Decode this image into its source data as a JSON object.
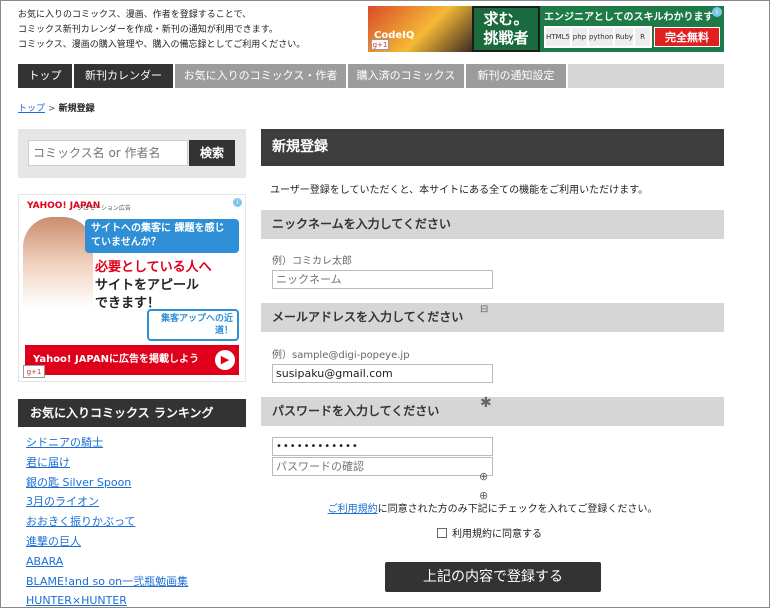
{
  "header": {
    "intro_lines": [
      "お気に入りのコミックス、漫画、作者を登録することで、",
      "コミックス新刊カレンダーを作成・新刊の通知が利用できます。",
      "コミックス、漫画の購入管理や、購入の備忘録としてご利用ください。"
    ],
    "ad": {
      "left_text": "CodeIQ",
      "gplus": "g+1",
      "catch_line1": "求む。",
      "catch_line2": "挑戦者",
      "headline": "エンジニアとしてのスキルわかります",
      "logos": [
        "HTML5",
        "php",
        "python",
        "Ruby",
        "R"
      ],
      "free_label": "完全無料",
      "info_icon": "info-icon"
    }
  },
  "nav": {
    "items": [
      {
        "label": "トップ",
        "active": true
      },
      {
        "label": "新刊カレンダー",
        "active": true
      },
      {
        "label": "お気に入りのコミックス・作者",
        "active": false
      },
      {
        "label": "購入済のコミックス",
        "active": false
      },
      {
        "label": "新刊の通知設定",
        "active": false
      }
    ]
  },
  "breadcrumb": {
    "home": "トップ",
    "separator": ">",
    "current": "新規登録"
  },
  "search": {
    "placeholder": "コミックス名 or 作者名",
    "button": "検索"
  },
  "sidebar_ad": {
    "logo": "YAHOO! JAPAN",
    "promo_label": "プロモーション広告",
    "bubble": "サイトへの集客に 課題を感じていませんか？",
    "line1": "必要としている人へ",
    "line2": "サイトをアピール",
    "line3": "できます！",
    "badge": "集客アップへの近道！",
    "bar_text": "Yahoo! JAPANに広告を掲載しよう",
    "arrow": "▶",
    "gplus": "g+1",
    "info_icon": "info-icon"
  },
  "ranking": {
    "title": "お気に入りコミックス ランキング",
    "items": [
      "シドニアの騎士",
      "君に届け",
      "銀の匙 Silver Spoon",
      "3月のライオン",
      "おおきく振りかぶって",
      "進撃の巨人",
      "ABARA",
      "BLAME!and so on一弐瓶勉画集",
      "HUNTER×HUNTER"
    ]
  },
  "form": {
    "title": "新規登録",
    "intro": "ユーザー登録をしていただくと、本サイトにある全ての機能をご利用いただけます。",
    "nickname": {
      "heading": "ニックネームを入力してください",
      "example": "例）コミカレ太郎",
      "placeholder": "ニックネーム"
    },
    "email": {
      "heading": "メールアドレスを入力してください",
      "example": "例）sample@digi-popeye.jp",
      "value": "susipaku@gmail.com"
    },
    "password": {
      "heading": "パスワードを入力してください",
      "value": "••••••••••••",
      "confirm_placeholder": "パスワードの確認"
    },
    "terms_link": "ご利用規約",
    "terms_rest": "に同意された方のみ下記にチェックを入れてご登録ください。",
    "agree_label": "利用規約に同意する",
    "submit": "上記の内容で登録する"
  }
}
